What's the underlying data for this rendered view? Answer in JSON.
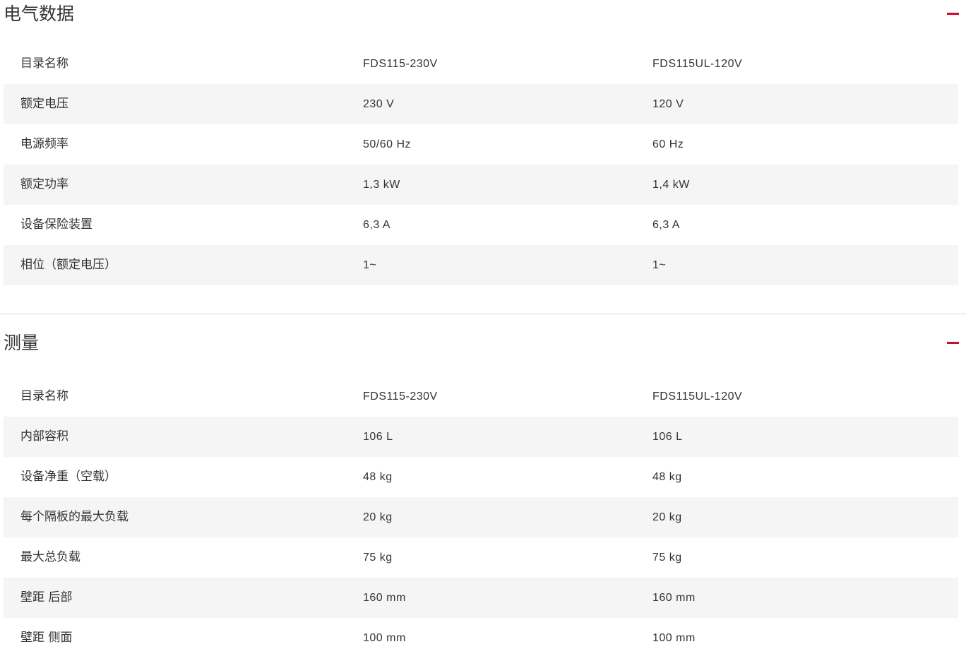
{
  "sections": [
    {
      "title": "电气数据",
      "rows": [
        [
          "目录名称",
          "FDS115-230V",
          "FDS115UL-120V"
        ],
        [
          "额定电压",
          "230 V",
          "120 V"
        ],
        [
          "电源频率",
          "50/60 Hz",
          "60 Hz"
        ],
        [
          "额定功率",
          "1,3 kW",
          "1,4 kW"
        ],
        [
          "设备保险装置",
          "6,3 A",
          "6,3 A"
        ],
        [
          "相位（额定电压）",
          "1~",
          "1~"
        ]
      ]
    },
    {
      "title": "测量",
      "rows": [
        [
          "目录名称",
          "FDS115-230V",
          "FDS115UL-120V"
        ],
        [
          "内部容积",
          "106 L",
          "106 L"
        ],
        [
          "设备净重（空载）",
          "48 kg",
          "48 kg"
        ],
        [
          "每个隔板的最大负载",
          "20 kg",
          "20 kg"
        ],
        [
          "最大总负载",
          "75 kg",
          "75 kg"
        ],
        [
          "壁距 后部",
          "160 mm",
          "160 mm"
        ],
        [
          "壁距 侧面",
          "100 mm",
          "100 mm"
        ]
      ]
    }
  ],
  "icons": {
    "collapse": "minus-icon"
  },
  "colors": {
    "accent": "#c8102e",
    "stripe": "#f5f5f5",
    "divider": "#d6d6d6"
  }
}
